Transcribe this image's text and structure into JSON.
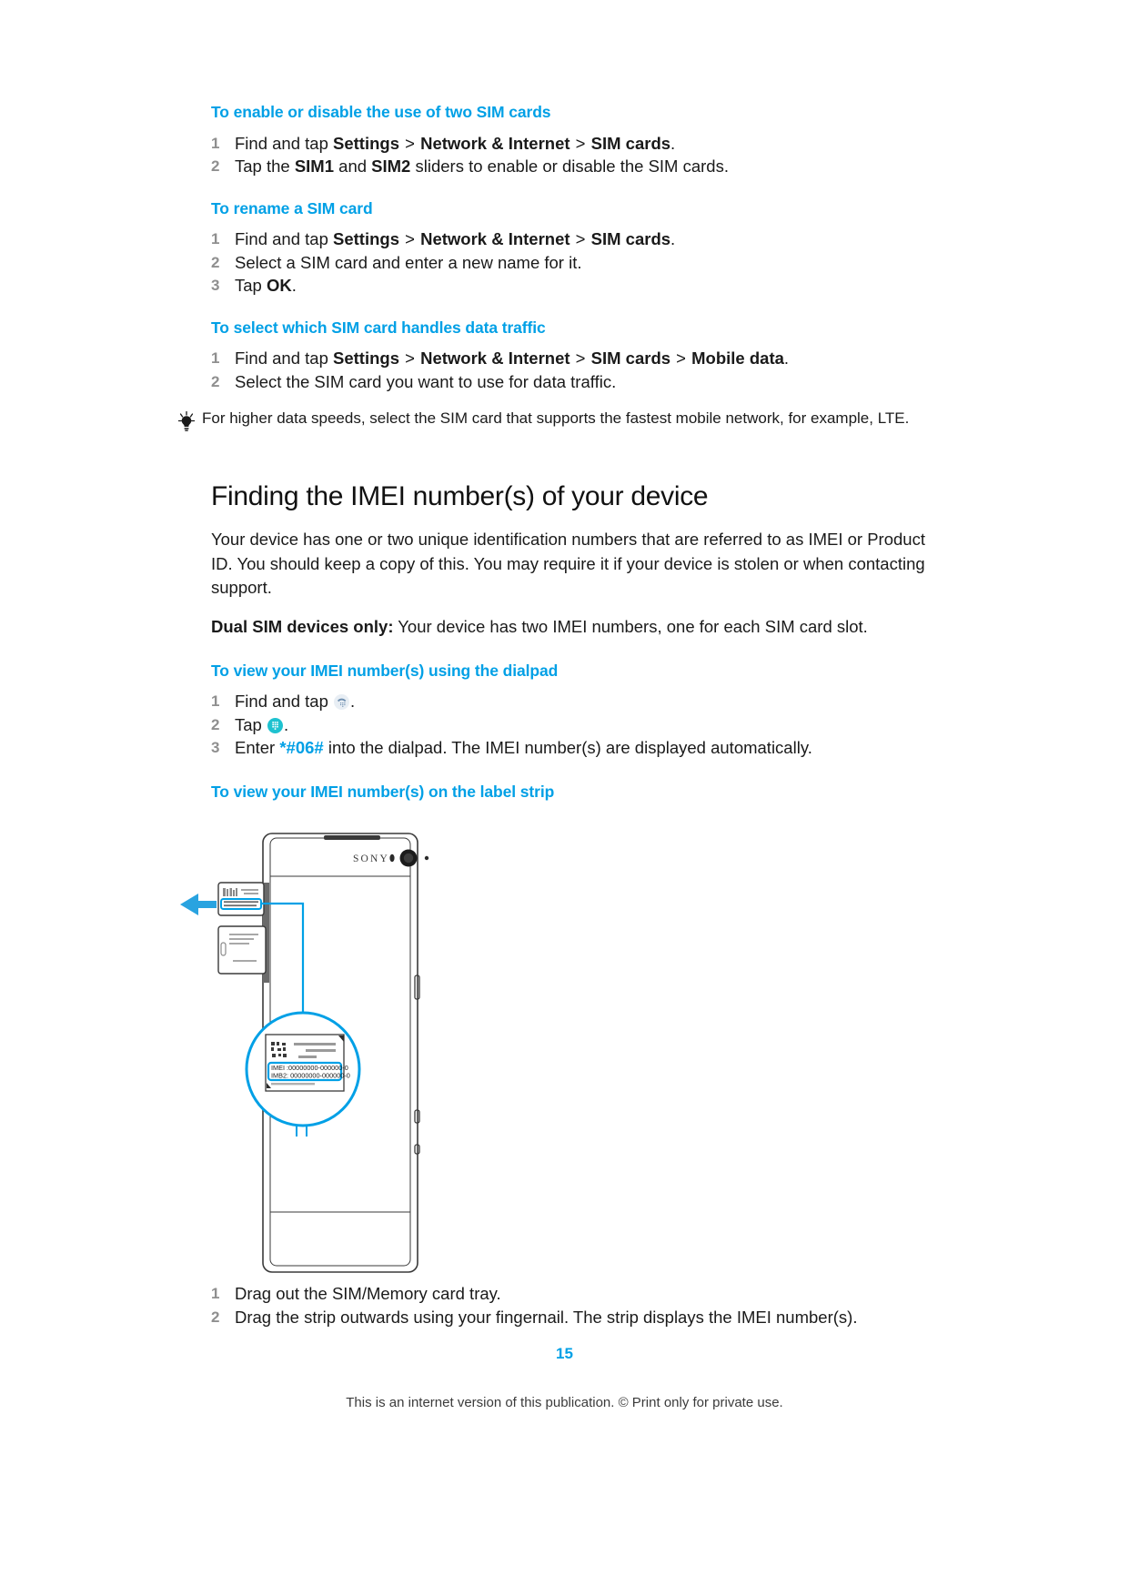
{
  "document": {
    "page_number": "15",
    "footer_note": "This is an internet version of this publication. © Print only for private use.",
    "accent_color": "#00a0e6",
    "step_number_color": "#8f8f8f"
  },
  "sections": [
    {
      "heading": "To enable or disable the use of two SIM cards",
      "steps": [
        {
          "num": "1",
          "parts": [
            {
              "t": "Find and tap ",
              "b": false
            },
            {
              "t": "Settings",
              "b": true
            },
            {
              "t": " > ",
              "b": false
            },
            {
              "t": "Network & Internet",
              "b": true
            },
            {
              "t": " > ",
              "b": false
            },
            {
              "t": "SIM cards",
              "b": true
            },
            {
              "t": ".",
              "b": false
            }
          ]
        },
        {
          "num": "2",
          "parts": [
            {
              "t": "Tap the ",
              "b": false
            },
            {
              "t": "SIM1",
              "b": true
            },
            {
              "t": " and ",
              "b": false
            },
            {
              "t": "SIM2",
              "b": true
            },
            {
              "t": " sliders to enable or disable the SIM cards.",
              "b": false
            }
          ]
        }
      ]
    },
    {
      "heading": "To rename a SIM card",
      "steps": [
        {
          "num": "1",
          "parts": [
            {
              "t": "Find and tap ",
              "b": false
            },
            {
              "t": "Settings",
              "b": true
            },
            {
              "t": " > ",
              "b": false
            },
            {
              "t": "Network & Internet",
              "b": true
            },
            {
              "t": " > ",
              "b": false
            },
            {
              "t": "SIM cards",
              "b": true
            },
            {
              "t": ".",
              "b": false
            }
          ]
        },
        {
          "num": "2",
          "parts": [
            {
              "t": "Select a SIM card and enter a new name for it.",
              "b": false
            }
          ]
        },
        {
          "num": "3",
          "parts": [
            {
              "t": "Tap ",
              "b": false
            },
            {
              "t": "OK",
              "b": true
            },
            {
              "t": ".",
              "b": false
            }
          ]
        }
      ]
    },
    {
      "heading": "To select which SIM card handles data traffic",
      "steps": [
        {
          "num": "1",
          "parts": [
            {
              "t": "Find and tap ",
              "b": false
            },
            {
              "t": "Settings",
              "b": true
            },
            {
              "t": " > ",
              "b": false
            },
            {
              "t": "Network & Internet",
              "b": true
            },
            {
              "t": " > ",
              "b": false
            },
            {
              "t": "SIM cards",
              "b": true
            },
            {
              "t": " > ",
              "b": false
            },
            {
              "t": "Mobile data",
              "b": true
            },
            {
              "t": ".",
              "b": false
            }
          ]
        },
        {
          "num": "2",
          "parts": [
            {
              "t": "Select the SIM card you want to use for data traffic.",
              "b": false
            }
          ]
        }
      ]
    }
  ],
  "tip": {
    "icon": "lightbulb-icon",
    "text": "For higher data speeds, select the SIM card that supports the fastest mobile network, for example, LTE."
  },
  "imei_section": {
    "title": "Finding the IMEI number(s) of your device",
    "paragraph_1": "Your device has one or two unique identification numbers that are referred to as IMEI or Product ID. You should keep a copy of this. You may require it if your device is stolen or when contacting support.",
    "paragraph_2_bold": "Dual SIM devices only:",
    "paragraph_2_rest": " Your device has two IMEI numbers, one for each SIM card slot.",
    "dialpad_heading": "To view your IMEI number(s) using the dialpad",
    "dialpad_steps": [
      {
        "num": "1",
        "before": "Find and tap ",
        "icon": "phone-handset-icon",
        "after": "."
      },
      {
        "num": "2",
        "before": "Tap ",
        "icon": "dialpad-icon",
        "after": "."
      },
      {
        "num": "3",
        "before": "Enter ",
        "code": "*#06#",
        "after": " into the dialpad. The IMEI number(s) are displayed automatically."
      }
    ],
    "label_strip_heading": "To view your IMEI number(s) on the label strip",
    "label_steps": [
      {
        "num": "1",
        "text": "Drag out the SIM/Memory card tray."
      },
      {
        "num": "2",
        "text": "Drag the strip outwards using your fingernail. The strip displays the IMEI number(s)."
      }
    ]
  },
  "illustration": {
    "brand_text": "SONY",
    "imei_line_1": "IMEI :00000000-000000-0",
    "imei_line_2": "IMB2: 00000000-000000-0",
    "callout_color": "#00a0e6",
    "arrow_color": "#29a3e0"
  }
}
